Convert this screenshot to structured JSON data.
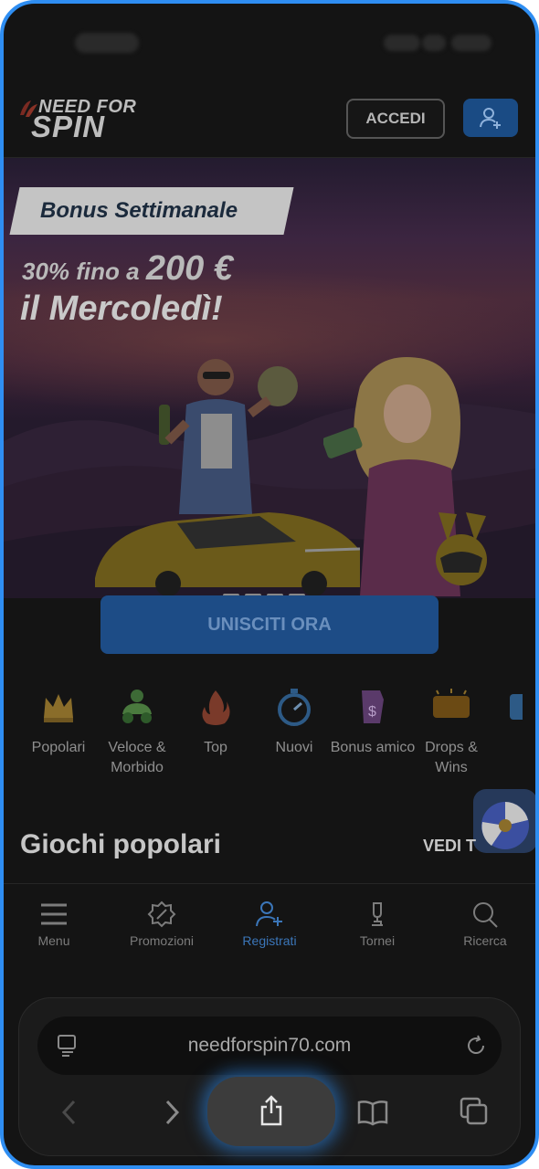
{
  "header": {
    "logo_top": "NEED FOR",
    "logo_bottom": "SPIN",
    "login_label": "ACCEDI"
  },
  "banner": {
    "tag": "Bonus Settimanale",
    "line1_prefix": "30% fino a ",
    "line1_amount": "200 €",
    "line2": "il Mercoledì!",
    "cta": "UNISCITI ORA"
  },
  "categories": [
    {
      "label": "Popolari",
      "icon": "crown-icon"
    },
    {
      "label": "Veloce & Morbido",
      "icon": "car-icon"
    },
    {
      "label": "Top",
      "icon": "fire-icon"
    },
    {
      "label": "Nuovi",
      "icon": "stopwatch-icon"
    },
    {
      "label": "Bonus amico",
      "icon": "bonus-icon"
    },
    {
      "label": "Drops & Wins",
      "icon": "drops-icon"
    }
  ],
  "section": {
    "title": "Giochi popolari",
    "see_all": "VEDI T"
  },
  "nav": [
    {
      "label": "Menu",
      "icon": "menu-icon"
    },
    {
      "label": "Promozioni",
      "icon": "promo-icon"
    },
    {
      "label": "Registrati",
      "icon": "user-plus-icon"
    },
    {
      "label": "Tornei",
      "icon": "trophy-icon"
    },
    {
      "label": "Ricerca",
      "icon": "search-icon"
    }
  ],
  "browser": {
    "url": "needforspin70.com"
  },
  "colors": {
    "accent_blue": "#2f8ef2",
    "button_blue": "#1d4c86",
    "active_nav": "#3b76b9"
  }
}
